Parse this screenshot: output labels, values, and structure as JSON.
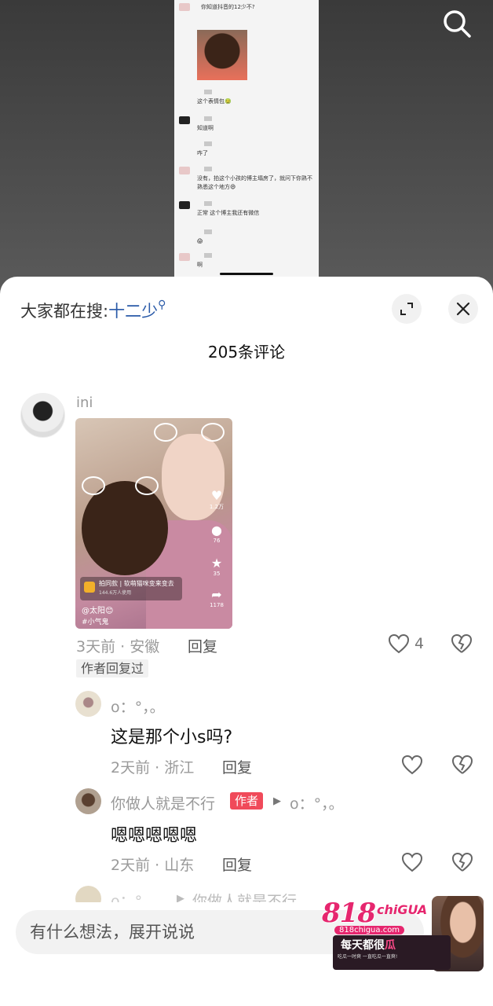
{
  "video": {
    "chat": [
      {
        "text": "你知道抖音的12少不?",
        "time": "",
        "avatar": "pink"
      },
      {
        "text": "这个表情包🤢",
        "time": "",
        "avatar": "none"
      },
      {
        "text": "知道啊",
        "time": "",
        "avatar": "dark"
      },
      {
        "text": "咋了",
        "time": "",
        "avatar": "none"
      },
      {
        "text": "没有，拍这个小孩的博主塌房了，就问下你熟不熟悉这个地方😄",
        "time": "",
        "avatar": "pink"
      },
      {
        "text": "正常 这个博主我还有微信",
        "time": "",
        "avatar": "dark"
      },
      {
        "text": "😱",
        "time": "",
        "avatar": "none"
      },
      {
        "text": "啊",
        "time": "",
        "avatar": "pink"
      }
    ]
  },
  "sheet": {
    "trending_prefix": "大家都在搜:",
    "trending_keyword": "十二少",
    "comment_count": "205条评论"
  },
  "comments": [
    {
      "user": "ini",
      "thumbnail": {
        "effect_title": "拍同款 | 软萌猫咪变来变去",
        "effect_users": "144.6万人使用",
        "author": "@太阳😊",
        "tag": "#小气鬼",
        "likes": "1.2万",
        "comments": "76",
        "favorites": "35",
        "shares": "1178"
      },
      "meta": "3天前 · 安徽",
      "reply_label": "回复",
      "like_count": "4",
      "badge": "作者回复过"
    }
  ],
  "replies": [
    {
      "user": "o：°，。",
      "text": "这是那个小s吗?",
      "meta": "2天前 · 浙江",
      "reply_label": "回复"
    },
    {
      "user": "你做人就是不行",
      "author_badge": "作者",
      "reply_to": "o：°，。",
      "text": "嗯嗯嗯嗯嗯",
      "meta": "2天前 · 山东",
      "reply_label": "回复"
    },
    {
      "user": "o：°",
      "reply_to": "你做人就是不行"
    }
  ],
  "input": {
    "placeholder": "有什么想法，展开说说"
  },
  "watermark": {
    "logo": "818",
    "logo_suffix": "chiGUA",
    "site": "818chigua.com",
    "slogan_a": "每天都很",
    "slogan_b": "瓜",
    "tagline": "吃瓜一时爽 一直吃瓜一直爽!"
  },
  "colors": {
    "accent_link": "#2a5aa8",
    "author_badge": "#f04a5a",
    "watermark_pink": "#e6266e"
  }
}
